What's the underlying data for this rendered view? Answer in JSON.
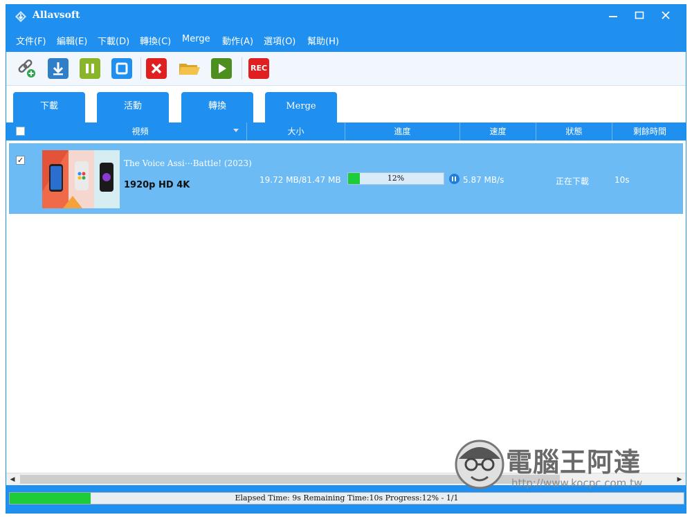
{
  "window": {
    "title": "Allavsoft"
  },
  "menu": [
    "文件(F)",
    "編輯(E)",
    "下載(D)",
    "轉換(C)",
    "Merge",
    "動作(A)",
    "選項(O)",
    "幫助(H)"
  ],
  "toolbar": {
    "rec_label": "REC"
  },
  "tabs": [
    "下載",
    "活動",
    "轉換",
    "Merge"
  ],
  "columns": [
    "視頻",
    "大小",
    "進度",
    "速度",
    "狀態",
    "剩餘時間"
  ],
  "download": {
    "title": "The Voice Assi⋯Battle! (2023)",
    "quality": "1920p HD 4K",
    "size": "19.72 MB/81.47 MB",
    "progress_percent": 12,
    "progress_label": "12%",
    "speed": "5.87 MB/s",
    "status": "正在下載",
    "remaining": "10s",
    "checked": true
  },
  "statusbar": {
    "text": "Elapsed Time: 9s Remaining Time:10s Progress:12% - 1/1",
    "progress_percent": 12
  },
  "watermark": {
    "text": "電腦王阿達",
    "url": "http://www.kocpc.com.tw"
  },
  "colors": {
    "accent": "#1f8ff0",
    "row_selected": "#6cbbf5",
    "progress": "#1ecc3a"
  }
}
